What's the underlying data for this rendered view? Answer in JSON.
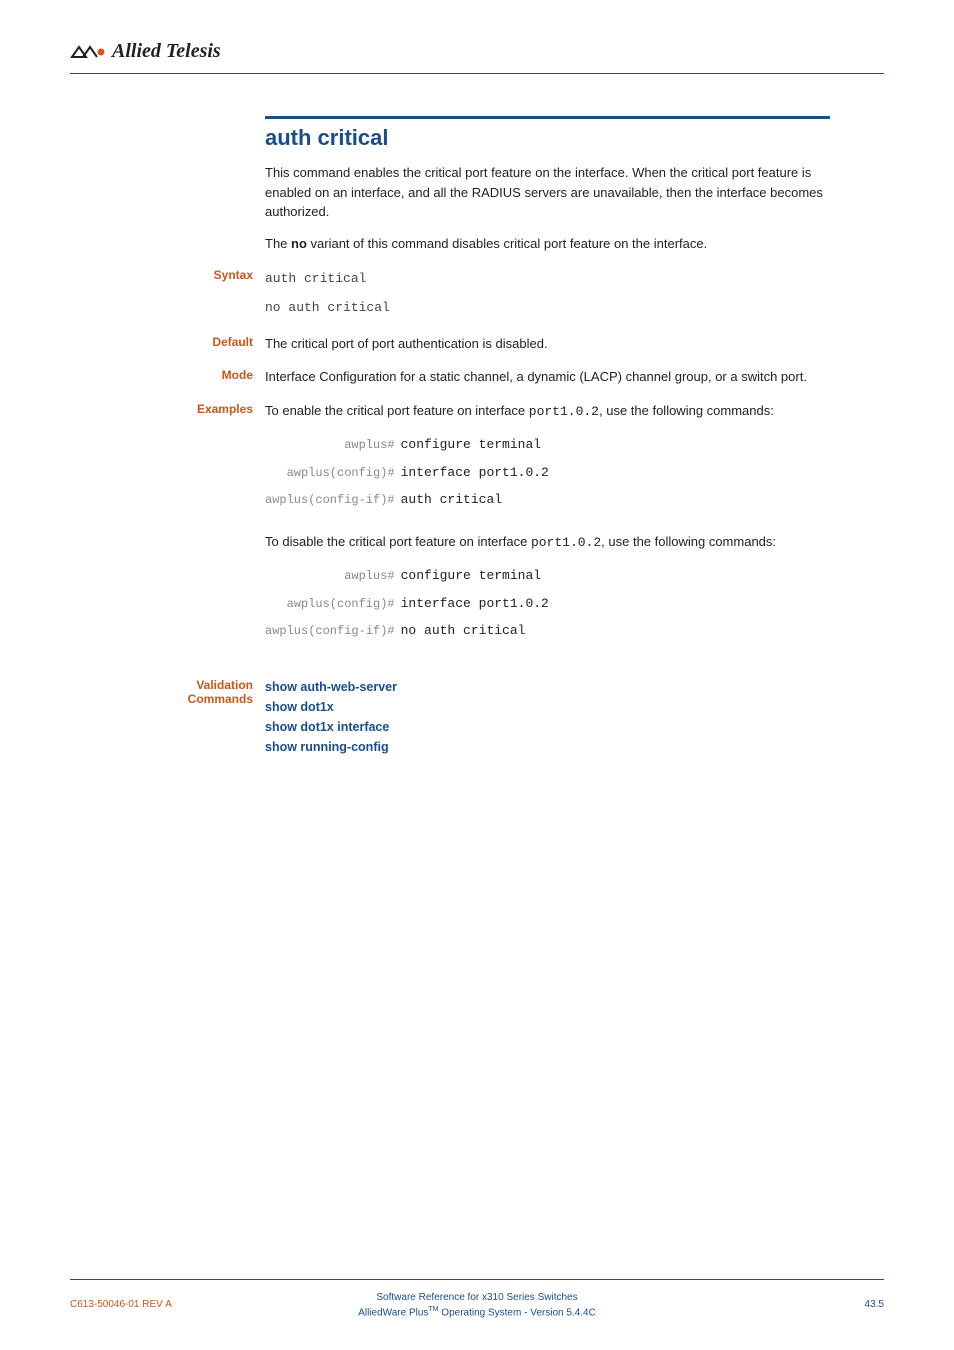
{
  "brand": "Allied Telesis",
  "section_title": "auth critical",
  "intro": {
    "p1": "This command enables the critical port feature on the interface. When the critical port feature is enabled on an interface, and all the RADIUS servers are unavailable, then the interface becomes authorized.",
    "p2_pre": "The ",
    "p2_bold": "no",
    "p2_post": " variant of this command disables critical port feature on the interface."
  },
  "syntax": {
    "label": "Syntax",
    "line1": "auth critical",
    "line2": "no auth critical"
  },
  "default": {
    "label": "Default",
    "text": "The critical port of port authentication is disabled."
  },
  "mode": {
    "label": "Mode",
    "text": "Interface Configuration for a static channel, a dynamic (LACP) channel group, or a switch port."
  },
  "examples": {
    "label": "Examples",
    "intro1_pre": "To enable the critical port feature on interface ",
    "intro1_code": "port1.0.2",
    "intro1_post": ", use the following commands:",
    "block1": [
      {
        "prompt": "awplus#",
        "cmd": "configure terminal"
      },
      {
        "prompt": "awplus(config)#",
        "cmd": "interface port1.0.2"
      },
      {
        "prompt": "awplus(config-if)#",
        "cmd": "auth critical"
      }
    ],
    "intro2_pre": "To disable the critical port feature on interface ",
    "intro2_code": "port1.0.2",
    "intro2_post": ", use the following commands:",
    "block2": [
      {
        "prompt": "awplus#",
        "cmd": "configure terminal"
      },
      {
        "prompt": "awplus(config)#",
        "cmd": "interface port1.0.2"
      },
      {
        "prompt": "awplus(config-if)#",
        "cmd": "no auth critical"
      }
    ]
  },
  "validation": {
    "label1": "Validation",
    "label2": "Commands",
    "links": [
      "show auth-web-server",
      "show dot1x",
      "show dot1x interface",
      "show running-config"
    ]
  },
  "footer": {
    "left": "C613-50046-01 REV A",
    "center1": "Software Reference for x310 Series Switches",
    "center2_a": "AlliedWare Plus",
    "center2_b": " Operating System - Version 5.4.4C",
    "right": "43.5"
  }
}
